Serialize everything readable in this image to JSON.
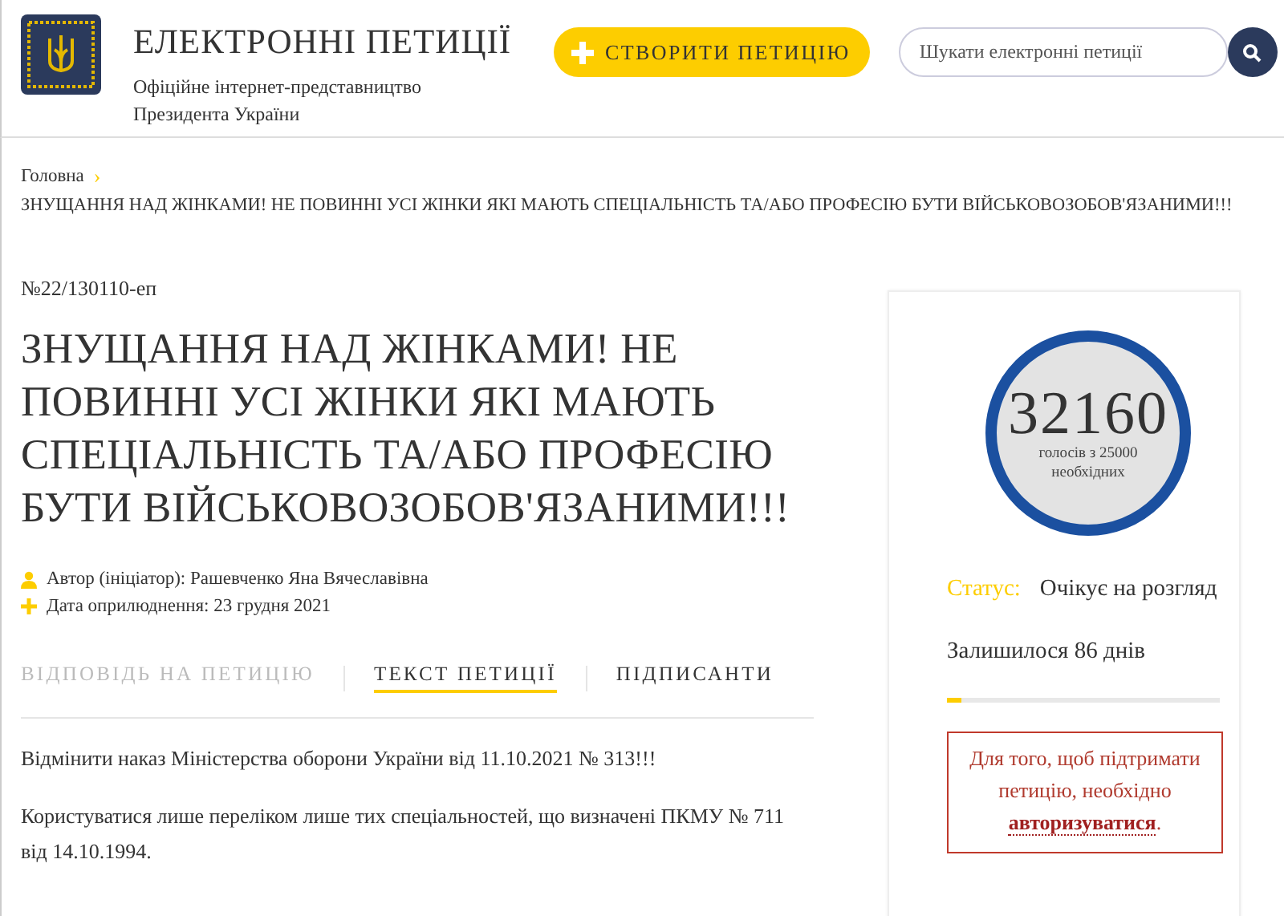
{
  "header": {
    "title": "ЕЛЕКТРОННІ ПЕТИЦІЇ",
    "subtitle": "Офіційне інтернет-представництво Президента України",
    "create_button": "СТВОРИТИ ПЕТИЦІЮ",
    "search": {
      "placeholder": "Шукати електронні петиції"
    }
  },
  "breadcrumb": {
    "home": "Головна",
    "separator": "›",
    "current": "ЗНУЩАННЯ НАД ЖІНКАМИ! НЕ ПОВИННІ УСІ ЖІНКИ ЯКІ МАЮТЬ СПЕЦІАЛЬНІСТЬ ТА/АБО ПРОФЕСІЮ БУТИ ВІЙСЬКОВОЗОБОВ'ЯЗАНИМИ!!!"
  },
  "petition": {
    "number": "№22/130110-еп",
    "title": "ЗНУЩАННЯ НАД ЖІНКАМИ! НЕ ПОВИННІ УСІ ЖІНКИ ЯКІ МАЮТЬ СПЕЦІАЛЬНІСТЬ ТА/АБО ПРОФЕСІЮ БУТИ ВІЙСЬКОВОЗОБОВ'ЯЗАНИМИ!!!",
    "meta": [
      {
        "kind": "author",
        "text": "Автор (ініціатор): Рашевченко Яна Вячеславівна"
      },
      {
        "kind": "date",
        "text": "Дата оприлюднення: 23 грудня 2021"
      }
    ],
    "tabs": [
      {
        "label": "ВІДПОВІДЬ НА ПЕТИЦІЮ",
        "selected": false,
        "disabled": true
      },
      {
        "label": "ТЕКСТ ПЕТИЦІЇ",
        "selected": true,
        "disabled": false
      },
      {
        "label": "ПІДПИСАНТИ",
        "selected": false,
        "disabled": false
      }
    ],
    "paragraphs": [
      "Відмінити наказ Міністерства оборони України від 11.10.2021 № 313!!!",
      "Користуватися лише переліком лише тих спеціальностей, що визначені ПКМУ № 711 від 14.10.1994."
    ]
  },
  "sidebar": {
    "votes": "32160",
    "votes_caption": "голосів з 25000 необхідних",
    "status_label": "Статус:",
    "status": "Очікує на розгляд",
    "days_left": "Залишилося 86 днів",
    "time_progress": {
      "level": 0.05
    },
    "auth_notice": {
      "text": "Для того, щоб підтримати петицію, необхідно",
      "link": "авторизуватися",
      "suffix": "."
    }
  }
}
